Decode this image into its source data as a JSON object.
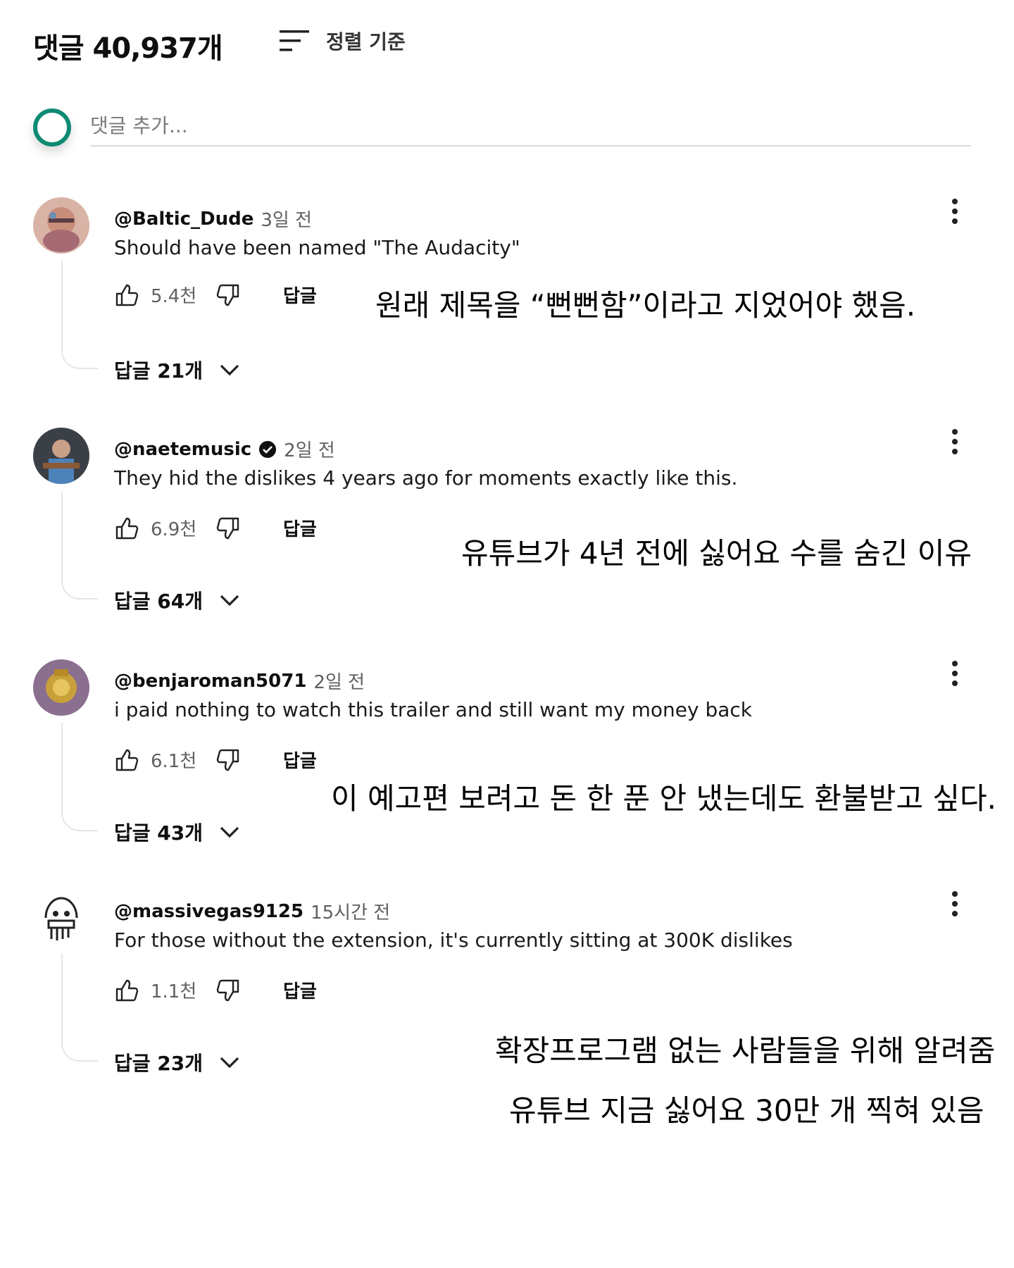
{
  "header": {
    "comment_count_title": "댓글 40,937개",
    "sort_label": "정렬 기준"
  },
  "add_comment": {
    "placeholder": "댓글 추가..."
  },
  "comments": [
    {
      "handle": "@Baltic_Dude",
      "verified": false,
      "time": "3일 전",
      "text": "Should have been named \"The Audacity\"",
      "likes": "5.4천",
      "reply_label": "답글",
      "replies_label": "답글 21개",
      "translation_lines": [
        "원래 제목을 “뻔뻔함”이라고 지었어야 했음."
      ]
    },
    {
      "handle": "@naetemusic",
      "verified": true,
      "time": "2일 전",
      "text": "They hid the dislikes 4 years ago for moments exactly like this.",
      "likes": "6.9천",
      "reply_label": "답글",
      "replies_label": "답글 64개",
      "translation_lines": [
        "유튜브가 4년 전에 싫어요 수를 숨긴 이유"
      ]
    },
    {
      "handle": "@benjaroman5071",
      "verified": false,
      "time": "2일 전",
      "text": "i paid nothing to watch this trailer and still want my money back",
      "likes": "6.1천",
      "reply_label": "답글",
      "replies_label": "답글 43개",
      "translation_lines": [
        "이 예고편 보려고 돈 한 푼 안 냈는데도 환불받고 싶다."
      ]
    },
    {
      "handle": "@massivegas9125",
      "verified": false,
      "time": "15시간 전",
      "text": "For those without the extension, it's currently sitting at 300K dislikes",
      "likes": "1.1천",
      "reply_label": "답글",
      "replies_label": "답글 23개",
      "translation_lines": [
        "확장프로그램 없는 사람들을 위해 알려줌",
        "유튜브 지금 싫어요 30만 개 찍혀 있음"
      ]
    }
  ]
}
